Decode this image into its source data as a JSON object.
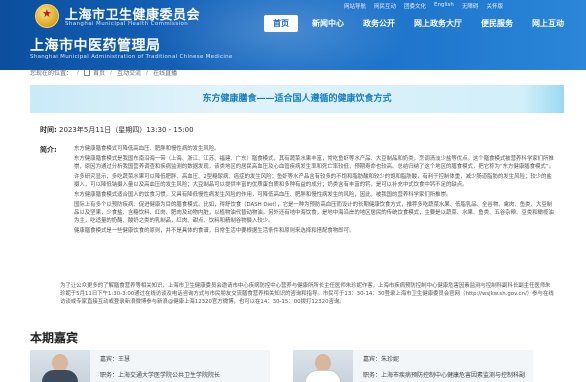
{
  "header": {
    "org_title": "上海市卫生健康委员会",
    "org_subtitle": "Shanghai Municipal Health Commission",
    "site_title": "上海市中医药管理局",
    "site_subtitle": "Shanghai Municipal Administration of Traditional Chinese Medicine",
    "top_links": [
      "网站导航",
      "网民互动",
      "团委文化",
      "English",
      "无障碍",
      "关怀版"
    ],
    "nav": [
      "首页",
      "新闻中心",
      "政务公开",
      "网上政务大厅",
      "便民服务",
      "网上互动"
    ],
    "active_nav": "首页"
  },
  "breadcrumb": {
    "label": "您现在的位置：",
    "items": [
      "首页",
      "互动交流",
      "在线直播"
    ]
  },
  "banner": {
    "title": "东方健康膳食——适合国人遵循的健康饮食方式"
  },
  "event": {
    "time_label": "时间:",
    "time_value": "2023年5月11日（星期四）13:30 - 15:00",
    "intro_label": "简介:",
    "intro_paragraphs": [
      "东方健康膳食模式可降低高血压、肥胖和慢性病的发生风险。",
      "东方健康膳食模式是我国东南沿海一带（上海、浙江、江苏、福建、广东）膳食模式，其有蔬菜水果丰富，常吃鱼虾等水产品、大豆制品和奶类，烹调清淡少盐等优点。这个膳食模式被营养科学家们所推崇，原因为通过分析我国营养调查和疾病监测的数据发现，该类地区的居民高血压及心血管疾病发生率和死亡率较低，预期寿命也较高。总结归纳了这个地区的膳食模式，把它称为“东方健康膳食模式”。",
      "许多研究显示，多吃蔬菜水果可以降低肥胖、高血压、2型糖尿病、癌症的发生风险；鱼虾等水产品含有较多的不饱和脂肪酸和较少的饱和脂肪酸，有利于控制体重，减少肠道脂肪的发生风险；较少的盐摄入，可以降低钠摄入量以及高血压的发生风险；大豆制品可以提供丰富的优质蛋白质和多种有益的成分；奶类含有丰富的钙，是可以补充中式饮食中钙不足的缺点。",
      "东方健康膳食模式适合国人的饮食习惯，又具有降低慢性病发生风险的作用，可降低高血压、肥胖和慢性病发生的风险，因此，被我国的营养科学家们所推崇。",
      "国际上有多个以预防疾病、促进健康为目的膳食模式。比如，得舒饮食（DASH Diet），它是一种为预防高血压而设计的长期健康饮食方式，推荐多吃蔬菜水果、低脂乳品、全谷物、禽肉、鱼类、大豆制品以及坚果，少食盐、含糖饮料、红肉、肥肉及动物内脏，以植物油代替动物油。另外还有地中海饮食，是地中海沿岸的地区居民的传统饮食模式，主要是以蔬菜、水果、鱼类、五谷杂粮、豆类和橄榄油为主，吃适量的奶酪、酸奶之类的乳制品，红肉、甜点、饮料和精制谷物摄入较少。",
      "健康膳食模式是一些健康饮食的原则，并不是具体的食谱，日常生活中要根据生活条件和原则来选择和搭配食物即可。"
    ],
    "summary": "为了让公众更多的了解膳食营养等相关知识，上海市卫生健康委员会邀请市中心疾病防控中心营养与健康所所长主任医师朱珍妮作客，上海市疾病预防控制中心健康危害因素监测与控制科副科长副主任医师朱珍妮于5月11日下午1:30-3:00通过在线访谈及电话咨询方式与市民朋友交流膳食营养相关知识的咨询和指导。市民可于13：30-14：30登录上海市卫生健康委员会官网（http://wsjkw.sh.gov.cn/）参与在线访谈或专家直接互动或登录新浪微博参与新浪@健康上海12320官方微博，也可以在14：30-15：00拨打12320咨询。"
  },
  "guests": {
    "section_title": "本期嘉宾",
    "guest_label": "嘉宾：",
    "role_label": "职务：",
    "items": [
      {
        "name": "王慧",
        "role": "上海交通大学医学院公共卫生学院院长"
      },
      {
        "name": "朱珍妮",
        "role": "上海市疾病预防控制中心健康危害因素监测与控制科副"
      }
    ]
  },
  "colors": {
    "header_start": "#0b4f9e",
    "header_end": "#2a86d8",
    "banner_text": "#1a7fbf",
    "active_nav_text": "#1665c0"
  }
}
